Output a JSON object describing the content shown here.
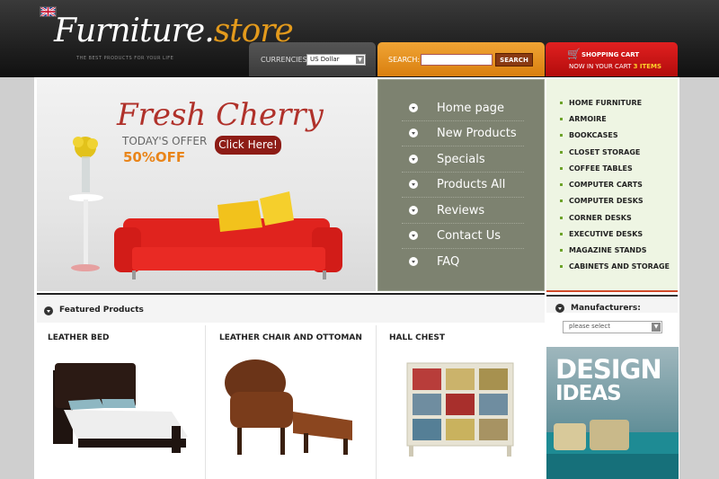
{
  "header": {
    "logo_part1": "Furniture.",
    "logo_part2": "store",
    "tagline": "THE BEST PRODUCTS FOR YOUR LIFE",
    "currencies_label": "CURRENCIES:",
    "currency_value": "US Dollar",
    "search_label": "SEARCH:",
    "search_button": "SEARCH",
    "cart_title": "SHOPPING CART",
    "cart_text": "NOW IN YOUR CART",
    "cart_count": "3 ITEMS"
  },
  "banner": {
    "title": "Fresh Cherry",
    "offer": "TODAY'S OFFER",
    "discount": "50%OFF",
    "button": "Click Here!"
  },
  "nav": {
    "items": [
      "Home page",
      "New Products",
      "Specials",
      "Products All",
      "Reviews",
      "Contact Us",
      "FAQ"
    ]
  },
  "categories": {
    "items": [
      "HOME FURNITURE",
      "ARMOIRE",
      "BOOKCASES",
      "CLOSET STORAGE",
      "COFFEE TABLES",
      "COMPUTER CARTS",
      "COMPUTER DESKS",
      "CORNER DESKS",
      "EXECUTIVE DESKS",
      "MAGAZINE STANDS",
      "CABINETS AND STORAGE"
    ]
  },
  "featured": {
    "title": "Featured Products",
    "products": [
      "LEATHER BED",
      "LEATHER CHAIR AND OTTOMAN",
      "HALL CHEST"
    ]
  },
  "manufacturers": {
    "title": "Manufacturers:",
    "placeholder": "please select"
  },
  "design": {
    "line1": "DESIGN",
    "line2": "IDEAS"
  },
  "colors": {
    "accent_orange": "#e39a1c",
    "cart_red": "#d01515",
    "nav_bg": "#7d8270",
    "category_bg": "#eef5e3"
  }
}
